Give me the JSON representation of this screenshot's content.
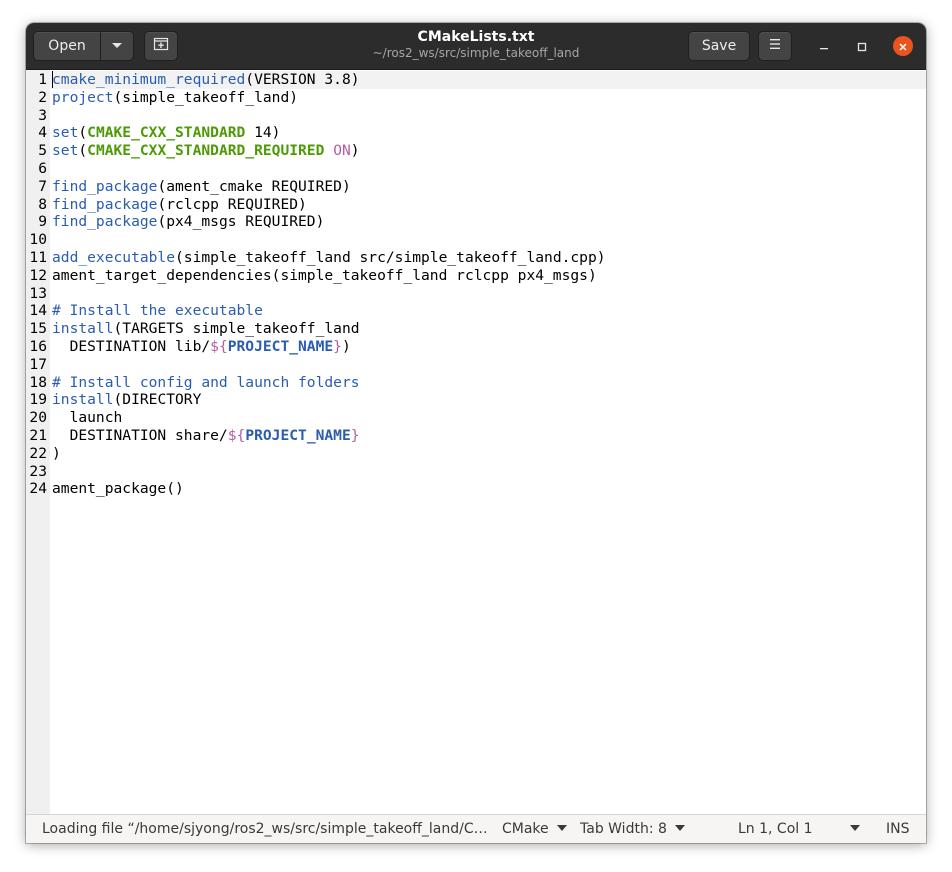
{
  "window": {
    "title": "CMakeLists.txt",
    "subtitle": "~/ros2_ws/src/simple_takeoff_land"
  },
  "headerbar": {
    "open_label": "Open",
    "open_menu_icon": "chevron-down-icon",
    "new_tab_icon": "new-tab-icon",
    "save_label": "Save",
    "menu_icon": "hamburger-menu-icon",
    "minimize_icon": "minimize-icon",
    "maximize_icon": "maximize-icon",
    "close_icon": "close-icon",
    "close_color": "#e95420"
  },
  "editor": {
    "current_line": 1,
    "lines": [
      {
        "n": "1",
        "text": "cmake_minimum_required(VERSION 3.8)"
      },
      {
        "n": "2",
        "text": "project(simple_takeoff_land)"
      },
      {
        "n": "3",
        "text": ""
      },
      {
        "n": "4",
        "text": "set(CMAKE_CXX_STANDARD 14)"
      },
      {
        "n": "5",
        "text": "set(CMAKE_CXX_STANDARD_REQUIRED ON)"
      },
      {
        "n": "6",
        "text": ""
      },
      {
        "n": "7",
        "text": "find_package(ament_cmake REQUIRED)"
      },
      {
        "n": "8",
        "text": "find_package(rclcpp REQUIRED)"
      },
      {
        "n": "9",
        "text": "find_package(px4_msgs REQUIRED)"
      },
      {
        "n": "10",
        "text": ""
      },
      {
        "n": "11",
        "text": "add_executable(simple_takeoff_land src/simple_takeoff_land.cpp)"
      },
      {
        "n": "12",
        "text": "ament_target_dependencies(simple_takeoff_land rclcpp px4_msgs)"
      },
      {
        "n": "13",
        "text": ""
      },
      {
        "n": "14",
        "text": "# Install the executable"
      },
      {
        "n": "15",
        "text": "install(TARGETS simple_takeoff_land"
      },
      {
        "n": "16",
        "text": "  DESTINATION lib/${PROJECT_NAME})"
      },
      {
        "n": "17",
        "text": ""
      },
      {
        "n": "18",
        "text": "# Install config and launch folders"
      },
      {
        "n": "19",
        "text": "install(DIRECTORY"
      },
      {
        "n": "20",
        "text": "  launch"
      },
      {
        "n": "21",
        "text": "  DESTINATION share/${PROJECT_NAME}"
      },
      {
        "n": "22",
        "text": ")"
      },
      {
        "n": "23",
        "text": ""
      },
      {
        "n": "24",
        "text": "ament_package()"
      }
    ]
  },
  "statusbar": {
    "loading_text": "Loading file “/home/sjyong/ros2_ws/src/simple_takeoff_land/C…",
    "language": "CMake",
    "tab_width": "Tab Width: 8",
    "position": "Ln 1, Col 1",
    "mode": "INS"
  }
}
